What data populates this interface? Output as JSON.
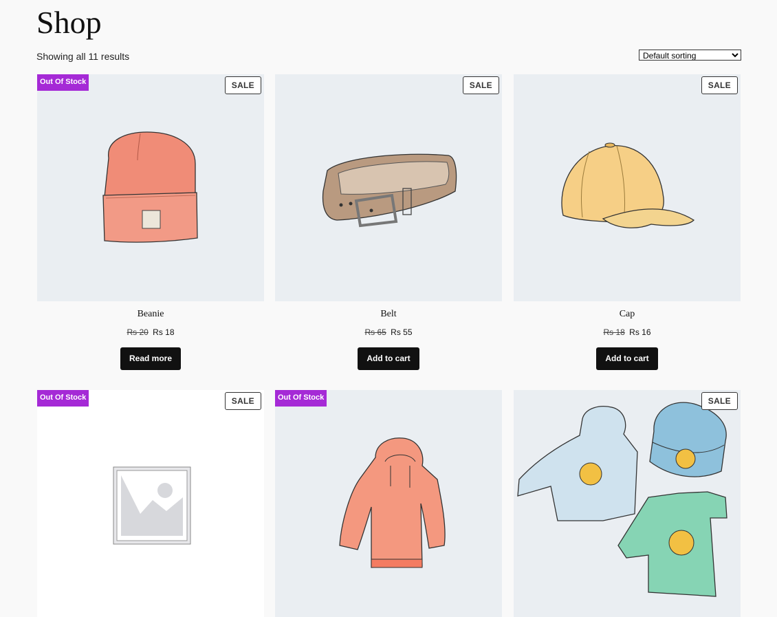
{
  "page": {
    "title": "Shop"
  },
  "toolbar": {
    "result_count": "Showing all 11 results",
    "sort_selected": "Default sorting"
  },
  "badges": {
    "out_of_stock": "Out Of Stock",
    "sale": "SALE"
  },
  "products": [
    {
      "name": "Beanie",
      "regular_price": "Rs 20",
      "sale_price": "Rs 18",
      "button": "Read more",
      "out_of_stock": true,
      "sale": true,
      "image": "beanie-image"
    },
    {
      "name": "Belt",
      "regular_price": "Rs 65",
      "sale_price": "Rs 55",
      "button": "Add to cart",
      "out_of_stock": false,
      "sale": true,
      "image": "belt-image"
    },
    {
      "name": "Cap",
      "regular_price": "Rs 18",
      "sale_price": "Rs 16",
      "button": "Add to cart",
      "out_of_stock": false,
      "sale": true,
      "image": "cap-image"
    },
    {
      "out_of_stock": true,
      "sale": true,
      "image": "placeholder-image"
    },
    {
      "out_of_stock": true,
      "sale": false,
      "image": "hoodie-image"
    },
    {
      "out_of_stock": false,
      "sale": true,
      "image": "logo-collection-image"
    }
  ],
  "colors": {
    "out_of_stock_badge": "#a52ad6",
    "button_background": "#111111",
    "image_background": "#eaeef2",
    "page_background": "#f9f9f9"
  }
}
